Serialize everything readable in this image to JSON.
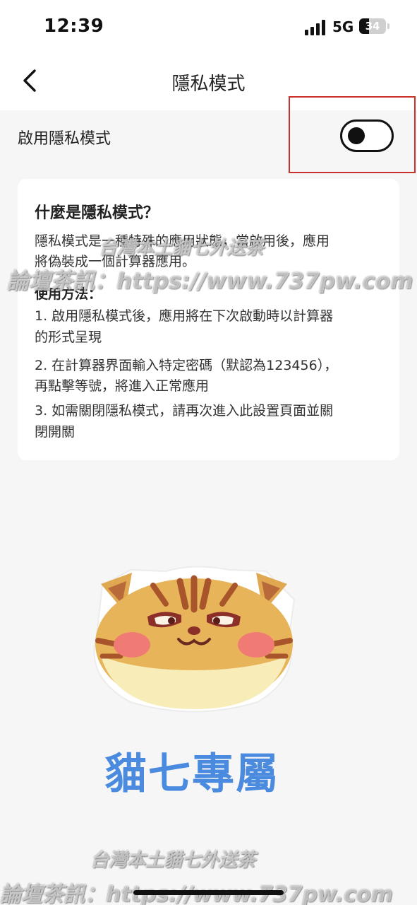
{
  "status_bar": {
    "time": "12:39",
    "network": "5G",
    "battery": "34"
  },
  "nav": {
    "title": "隱私模式"
  },
  "toggle": {
    "label": "啟用隱私模式",
    "state": "off"
  },
  "info": {
    "title": "什麼是隱私模式？",
    "desc_line1": "隱私模式是一種特殊的應用狀態，當啟用後，應用",
    "desc_line2": "將偽裝成一個計算器應用。",
    "usage_title": "使用方法：",
    "steps": [
      "1. 啟用隱私模式後，應用將在下次啟動時以計算器",
      "的形式呈現",
      "2. 在計算器界面輸入特定密碼（默認為123456），",
      "再點擊等號，將進入正常應用",
      "3. 如需關閉隱私模式，請再次進入此設置頁面並關",
      "閉開關"
    ]
  },
  "brand": {
    "text": "貓七專屬",
    "color": "#4a8adf"
  },
  "watermarks": {
    "line1": "台灣本土貓七外送茶",
    "line2": "論壇茶訊：https://www.737pw.com"
  },
  "colors": {
    "highlight": "#c8322a"
  },
  "icons": {
    "back": "back-chevron-icon",
    "mascot": "tabby-cat-face-icon"
  }
}
